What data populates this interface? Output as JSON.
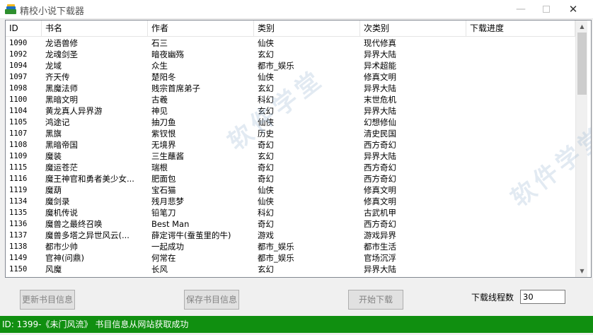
{
  "window": {
    "title": "精校小说下载器",
    "min_glyph": "—",
    "close_glyph": "✕"
  },
  "table": {
    "columns": [
      "ID",
      "书名",
      "作者",
      "类别",
      "次类别",
      "下载进度"
    ],
    "rows": [
      [
        "1090",
        "龙语兽修",
        "石三",
        "仙侠",
        "现代修真",
        ""
      ],
      [
        "1092",
        "龙魂剑圣",
        "暗夜幽殇",
        "玄幻",
        "异界大陆",
        ""
      ],
      [
        "1094",
        "龙域",
        "众生",
        "都市_娱乐",
        "异术超能",
        ""
      ],
      [
        "1097",
        "齐天传",
        "楚阳冬",
        "仙侠",
        "修真文明",
        ""
      ],
      [
        "1098",
        "黑魔法师",
        "贱宗首席弟子",
        "玄幻",
        "异界大陆",
        ""
      ],
      [
        "1100",
        "黑暗文明",
        "古羲",
        "科幻",
        "末世危机",
        ""
      ],
      [
        "1104",
        "黄龙真人异界游",
        "神见",
        "玄幻",
        "异界大陆",
        ""
      ],
      [
        "1105",
        "鸿途记",
        "抽刀鱼",
        "仙侠",
        "幻想修仙",
        ""
      ],
      [
        "1107",
        "黑旗",
        "紫钗恨",
        "历史",
        "清史民国",
        ""
      ],
      [
        "1108",
        "黑暗帝国",
        "无境界",
        "奇幻",
        "西方奇幻",
        ""
      ],
      [
        "1109",
        "魔装",
        "三生蘸酱",
        "玄幻",
        "异界大陆",
        ""
      ],
      [
        "1115",
        "魔运苍茫",
        "瑞根",
        "奇幻",
        "西方奇幻",
        ""
      ],
      [
        "1116",
        "魔王神官和勇者美少女...",
        "肥面包",
        "奇幻",
        "西方奇幻",
        ""
      ],
      [
        "1119",
        "魔葫",
        "宝石猫",
        "仙侠",
        "修真文明",
        ""
      ],
      [
        "1134",
        "魔剑录",
        "残月悲梦",
        "仙侠",
        "修真文明",
        ""
      ],
      [
        "1135",
        "魔机传说",
        "铅笔刀",
        "科幻",
        "古武机甲",
        ""
      ],
      [
        "1136",
        "魔兽之最终召唤",
        "Best Man",
        "奇幻",
        "西方奇幻",
        ""
      ],
      [
        "1137",
        "魔兽多塔之异世风云(...",
        "薛定谔牛(蚕茧里的牛)",
        "游戏",
        "游戏异界",
        ""
      ],
      [
        "1138",
        "都市少帅",
        "一起成功",
        "都市_娱乐",
        "都市生活",
        ""
      ],
      [
        "1149",
        "官神(问鼎)",
        "何常在",
        "都市_娱乐",
        "官场沉浮",
        ""
      ],
      [
        "1150",
        "风魔",
        "长风",
        "玄幻",
        "异界大陆",
        ""
      ]
    ]
  },
  "scrollbar": {
    "up_glyph": "▲",
    "down_glyph": "▼"
  },
  "watermark": {
    "text1": "软件学堂",
    "text2": "软件学堂"
  },
  "buttons": {
    "update": "更新书目信息",
    "save": "保存书目信息",
    "start": "开始下载"
  },
  "threads": {
    "label": "下载线程数",
    "value": "30"
  },
  "status": {
    "text": "ID: 1399-《未门风流》 书目信息从网站获取成功"
  },
  "colors": {
    "status_bg": "#108f10",
    "status_text": "#ffffff"
  }
}
